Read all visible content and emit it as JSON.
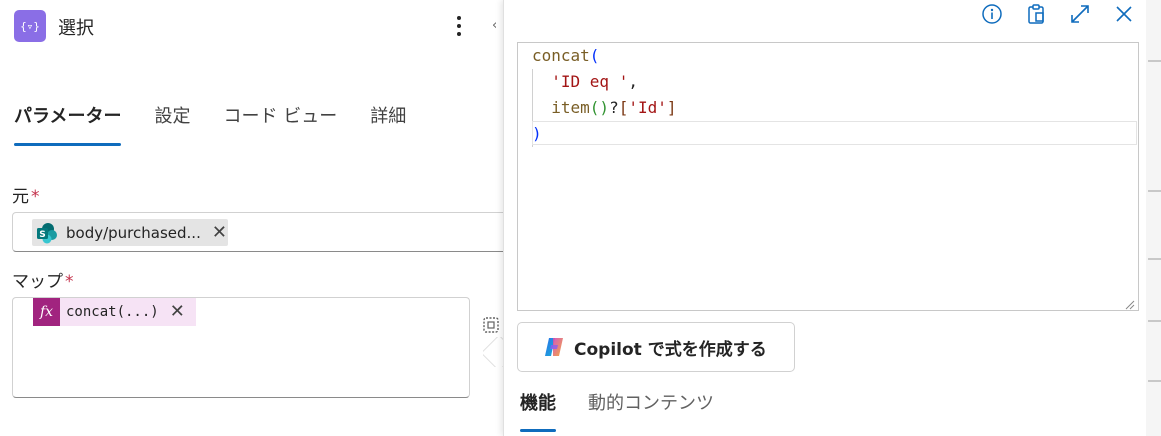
{
  "action": {
    "title": "選択",
    "icon": "filter-braces-icon",
    "accent_color": "#8a6ee6",
    "collapse_hint": "‹"
  },
  "tabs": [
    {
      "label": "パラメーター",
      "active": true
    },
    {
      "label": "設定",
      "active": false
    },
    {
      "label": "コード ビュー",
      "active": false
    },
    {
      "label": "詳細",
      "active": false
    }
  ],
  "fields": {
    "from": {
      "label": "元",
      "required_mark": "*",
      "token": {
        "text": "body/purchased...",
        "icon": "sharepoint-icon"
      }
    },
    "map": {
      "label": "マップ",
      "required_mark": "*",
      "token": {
        "text": "concat(...)",
        "icon": "fx-icon",
        "icon_text": "fx",
        "color": "#a1247f"
      }
    }
  },
  "editor": {
    "toolbar_icons": [
      "info-icon",
      "clipboard-icon",
      "expand-icon",
      "close-icon"
    ],
    "code": {
      "l1_fn": "concat",
      "l1_open": "(",
      "l2_str": "'ID eq '",
      "l2_comma": ",",
      "l3_fn": "item",
      "l3_parens": "()",
      "l3_q": "?",
      "l3_open": "[",
      "l3_str": "'Id'",
      "l3_close": "]",
      "l4_close": ")"
    }
  },
  "copilot_button": {
    "label": "Copilot で式を作成する",
    "icon": "copilot-icon"
  },
  "bottom_tabs": [
    {
      "label": "機能",
      "active": true
    },
    {
      "label": "動的コンテンツ",
      "active": false
    }
  ]
}
